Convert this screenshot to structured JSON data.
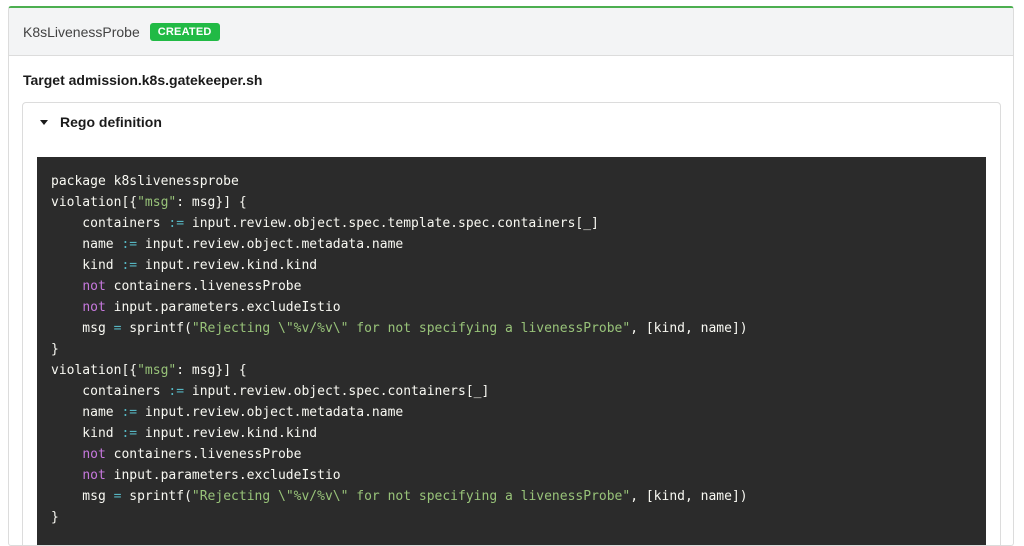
{
  "header": {
    "title": "K8sLivenessProbe",
    "status_badge": "CREATED"
  },
  "target_label": "Target admission.k8s.gatekeeper.sh",
  "accordion": {
    "title": "Rego definition"
  },
  "code": {
    "lines": [
      [
        {
          "t": "package k8slivenessprobe",
          "c": ""
        }
      ],
      [
        {
          "t": "violation[{",
          "c": ""
        },
        {
          "t": "\"msg\"",
          "c": "str"
        },
        {
          "t": ": msg}] {",
          "c": ""
        }
      ],
      [
        {
          "t": "    containers ",
          "c": ""
        },
        {
          "t": ":=",
          "c": "op"
        },
        {
          "t": " input.review.object.spec.template.spec.containers[_]",
          "c": ""
        }
      ],
      [
        {
          "t": "    name ",
          "c": ""
        },
        {
          "t": ":=",
          "c": "op"
        },
        {
          "t": " input.review.object.metadata.name",
          "c": ""
        }
      ],
      [
        {
          "t": "    kind ",
          "c": ""
        },
        {
          "t": ":=",
          "c": "op"
        },
        {
          "t": " input.review.kind.kind",
          "c": ""
        }
      ],
      [
        {
          "t": "    ",
          "c": ""
        },
        {
          "t": "not",
          "c": "kw"
        },
        {
          "t": " containers.livenessProbe",
          "c": ""
        }
      ],
      [
        {
          "t": "    ",
          "c": ""
        },
        {
          "t": "not",
          "c": "kw"
        },
        {
          "t": " input.parameters.excludeIstio",
          "c": ""
        }
      ],
      [
        {
          "t": "    msg ",
          "c": ""
        },
        {
          "t": "=",
          "c": "op"
        },
        {
          "t": " sprintf(",
          "c": ""
        },
        {
          "t": "\"Rejecting \\\"%v/%v\\\" for not specifying a livenessProbe\"",
          "c": "str"
        },
        {
          "t": ", [kind, name])",
          "c": ""
        }
      ],
      [
        {
          "t": "}",
          "c": ""
        }
      ],
      [
        {
          "t": "violation[{",
          "c": ""
        },
        {
          "t": "\"msg\"",
          "c": "str"
        },
        {
          "t": ": msg}] {",
          "c": ""
        }
      ],
      [
        {
          "t": "    containers ",
          "c": ""
        },
        {
          "t": ":=",
          "c": "op"
        },
        {
          "t": " input.review.object.spec.containers[_]",
          "c": ""
        }
      ],
      [
        {
          "t": "    name ",
          "c": ""
        },
        {
          "t": ":=",
          "c": "op"
        },
        {
          "t": " input.review.object.metadata.name",
          "c": ""
        }
      ],
      [
        {
          "t": "    kind ",
          "c": ""
        },
        {
          "t": ":=",
          "c": "op"
        },
        {
          "t": " input.review.kind.kind",
          "c": ""
        }
      ],
      [
        {
          "t": "    ",
          "c": ""
        },
        {
          "t": "not",
          "c": "kw"
        },
        {
          "t": " containers.livenessProbe",
          "c": ""
        }
      ],
      [
        {
          "t": "    ",
          "c": ""
        },
        {
          "t": "not",
          "c": "kw"
        },
        {
          "t": " input.parameters.excludeIstio",
          "c": ""
        }
      ],
      [
        {
          "t": "    msg ",
          "c": ""
        },
        {
          "t": "=",
          "c": "op"
        },
        {
          "t": " sprintf(",
          "c": ""
        },
        {
          "t": "\"Rejecting \\\"%v/%v\\\" for not specifying a livenessProbe\"",
          "c": "str"
        },
        {
          "t": ", [kind, name])",
          "c": ""
        }
      ],
      [
        {
          "t": "}",
          "c": ""
        }
      ]
    ]
  }
}
